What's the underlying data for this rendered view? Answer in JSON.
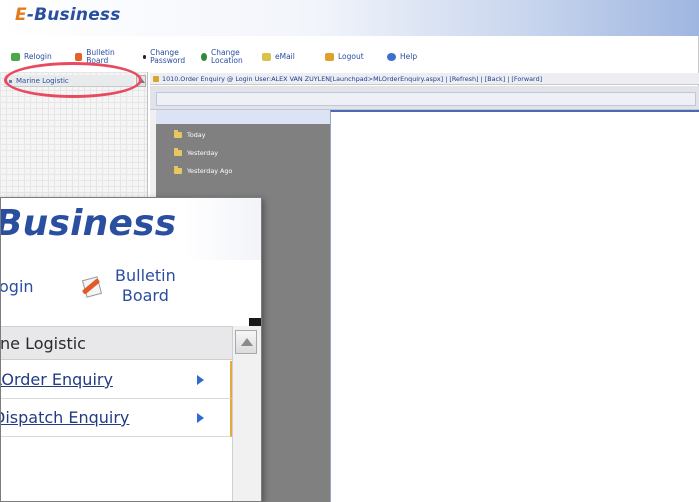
{
  "app": {
    "logo_e": "E",
    "logo_rest": "-Business",
    "zoom_logo": "Business"
  },
  "toolbar": {
    "relogin": "Relogin",
    "bulletin_board": "Bulletin Board",
    "change_password": "Change Password",
    "change_location": "Change Location",
    "email": "eMail",
    "logout": "Logout",
    "help": "Help"
  },
  "sidebar": {
    "header": "Marine Logistic"
  },
  "status_bar": {
    "text": "1010.Order Enquiry @ Login User:ALEX VAN ZUYLEN[Launchpad>MLOrderEnquiry.aspx] | [Refresh] | [Back] | [Forward]"
  },
  "tree": {
    "items": [
      "Today",
      "Yesterday",
      "Yesterday Ago"
    ]
  },
  "zoom": {
    "relogin_partial": "ogin",
    "bulletin_line1": "Bulletin",
    "bulletin_line2": "Board",
    "sidebar_header_partial": "rine Logistic",
    "menu": [
      {
        "label": "Order Enquiry",
        "display": "LOrder Enquiry"
      },
      {
        "label": "Dispatch Enquiry",
        "display": "Dispatch Enquiry"
      }
    ]
  },
  "colors": {
    "brand_blue": "#2a4fa0",
    "brand_orange": "#e57a18",
    "highlight": "#e84a5f"
  }
}
